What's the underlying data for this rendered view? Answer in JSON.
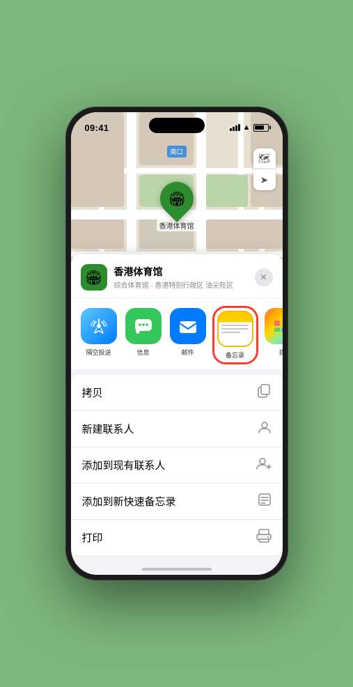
{
  "status_bar": {
    "time": "09:41",
    "signal": "full",
    "wifi": "on",
    "battery": "75"
  },
  "map": {
    "label": "南口",
    "controls": [
      "🗺️",
      "➤"
    ]
  },
  "pin": {
    "label": "香港体育馆",
    "emoji": "🏟"
  },
  "sheet": {
    "venue_name": "香港体育馆",
    "venue_sub": "综合体育馆 · 香港特别行政区 油尖旺区",
    "close_label": "✕"
  },
  "share_items": [
    {
      "id": "airdrop",
      "label": "隔空投送",
      "emoji": "📡"
    },
    {
      "id": "messages",
      "label": "信息",
      "emoji": "💬"
    },
    {
      "id": "mail",
      "label": "邮件",
      "emoji": "✉️"
    },
    {
      "id": "notes",
      "label": "备忘录",
      "emoji": ""
    },
    {
      "id": "more",
      "label": "提",
      "emoji": "⋯"
    }
  ],
  "actions": [
    {
      "label": "拷贝",
      "icon": "⧉"
    },
    {
      "label": "新建联系人",
      "icon": "👤"
    },
    {
      "label": "添加到现有联系人",
      "icon": "👤+"
    },
    {
      "label": "添加到新快速备忘录",
      "icon": "📋"
    },
    {
      "label": "打印",
      "icon": "🖨"
    }
  ]
}
